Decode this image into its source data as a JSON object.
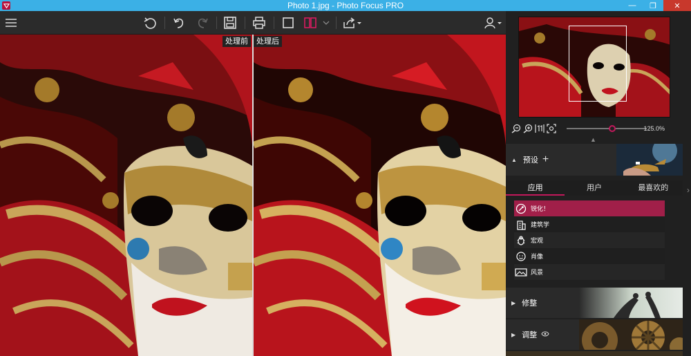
{
  "window": {
    "title": "Photo 1.jpg - Photo Focus PRO",
    "controls": [
      "minimize-icon",
      "maximize-icon",
      "close-icon"
    ]
  },
  "toolbar": {
    "icons": [
      "menu-icon",
      "rotate-left-icon",
      "undo-icon",
      "redo-icon",
      "save-icon",
      "print-icon",
      "single-view-icon",
      "split-view-icon",
      "chevron-down-icon",
      "share-icon",
      "user-icon"
    ]
  },
  "viewer": {
    "before_label": "处理前",
    "after_label": "处理后"
  },
  "navigator": {
    "zoom_value": "125.0%",
    "zoom_fraction": 0.57
  },
  "sections": {
    "presets_title": "预设",
    "retouch_title": "修整",
    "adjust_title": "调整"
  },
  "tabs": [
    "应用",
    "用户",
    "最喜欢的"
  ],
  "presets": [
    {
      "label": "锐化！",
      "icon": "sharpen-icon",
      "active": true
    },
    {
      "label": "建筑学",
      "icon": "building-icon",
      "active": false
    },
    {
      "label": "宏观",
      "icon": "bug-icon",
      "active": false
    },
    {
      "label": "肖像",
      "icon": "portrait-icon",
      "active": false
    },
    {
      "label": "风景",
      "icon": "landscape-icon",
      "active": false
    }
  ],
  "colors": {
    "titlebar": "#3bb0e6",
    "accent": "#c2185b",
    "active_preset": "#a11f49"
  }
}
